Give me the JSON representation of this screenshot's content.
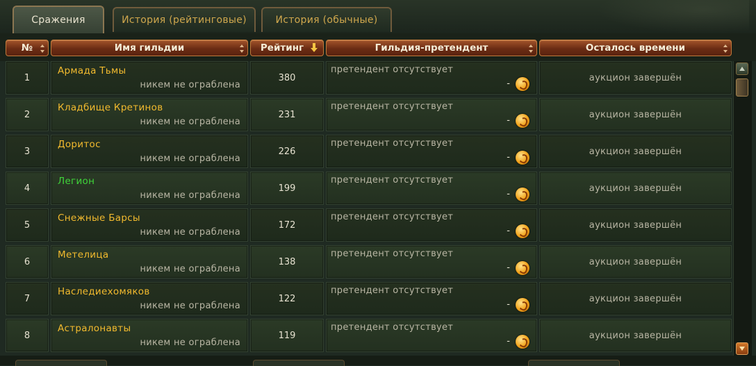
{
  "tabs": [
    {
      "label": "Сражения",
      "active": true
    },
    {
      "label": "История (рейтинговые)",
      "active": false
    },
    {
      "label": "История (обычные)",
      "active": false
    }
  ],
  "columns": {
    "num": "№",
    "guild": "Имя гильдии",
    "rating": "Рейтинг",
    "contender": "Гильдия-претендент",
    "time_left": "Осталось времени"
  },
  "sorted_column": "rating",
  "sort_direction": "descending",
  "colors": {
    "guild_name": "#f2ba2e",
    "guild_name_highlight": "#3fd43a",
    "header_bg": "#6b2c14",
    "row_bg": "#25301f"
  },
  "icons": {
    "bid": "gold-coin-icon",
    "scroll_up": "arrow-up-icon",
    "scroll_down": "arrow-down-icon"
  },
  "rows": [
    {
      "num": "1",
      "name": "Армада Тьмы",
      "status": "никем не ограблена",
      "rating": "380",
      "contender": "претендент отсутствует",
      "bid": "-",
      "time_left": "аукцион завершён",
      "highlight": false
    },
    {
      "num": "2",
      "name": "Кладбище Кретинов",
      "status": "никем не ограблена",
      "rating": "231",
      "contender": "претендент отсутствует",
      "bid": "-",
      "time_left": "аукцион завершён",
      "highlight": false
    },
    {
      "num": "3",
      "name": "Доритос",
      "status": "никем не ограблена",
      "rating": "226",
      "contender": "претендент отсутствует",
      "bid": "-",
      "time_left": "аукцион завершён",
      "highlight": false
    },
    {
      "num": "4",
      "name": "Легион",
      "status": "никем не ограблена",
      "rating": "199",
      "contender": "претендент отсутствует",
      "bid": "-",
      "time_left": "аукцион завершён",
      "highlight": true
    },
    {
      "num": "5",
      "name": "Снежные Барсы",
      "status": "никем не ограблена",
      "rating": "172",
      "contender": "претендент отсутствует",
      "bid": "-",
      "time_left": "аукцион завершён",
      "highlight": false
    },
    {
      "num": "6",
      "name": "Метелица",
      "status": "никем не ограблена",
      "rating": "138",
      "contender": "претендент отсутствует",
      "bid": "-",
      "time_left": "аукцион завершён",
      "highlight": false
    },
    {
      "num": "7",
      "name": "Наследиехомяков",
      "status": "никем не ограблена",
      "rating": "122",
      "contender": "претендент отсутствует",
      "bid": "-",
      "time_left": "аукцион завершён",
      "highlight": false
    },
    {
      "num": "8",
      "name": "Астралонавты",
      "status": "никем не ограблена",
      "rating": "119",
      "contender": "претендент отсутствует",
      "bid": "-",
      "time_left": "аукцион завершён",
      "highlight": false
    }
  ]
}
